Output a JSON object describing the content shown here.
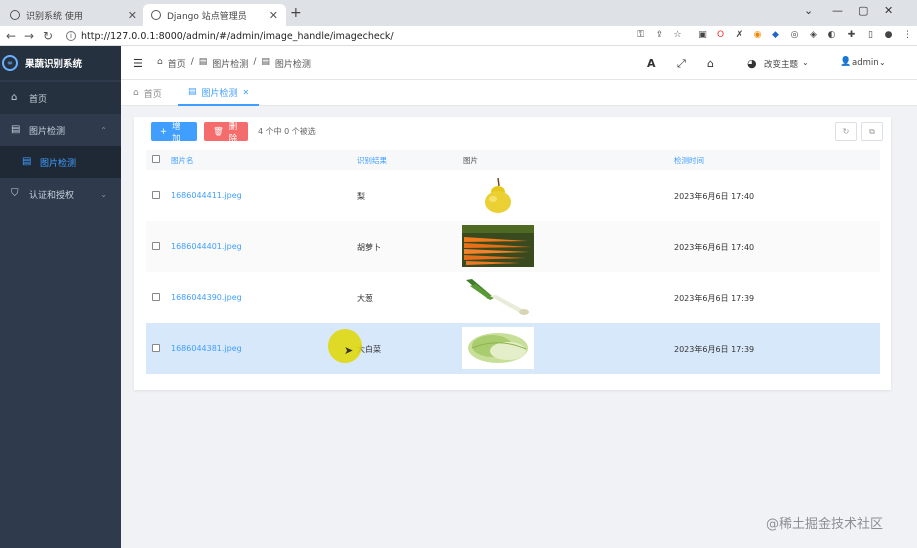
{
  "browser": {
    "tabs": [
      {
        "title": "识别系统 使用"
      },
      {
        "title": "Django 站点管理员"
      }
    ],
    "url": "http://127.0.0.1:8000/admin/#/admin/image_handle/imagecheck/"
  },
  "sidebar": {
    "brand": "果蔬识别系统",
    "items": [
      {
        "label": "首页",
        "icon": "home-icon"
      },
      {
        "label": "图片检测",
        "icon": "image-icon"
      },
      {
        "label": "图片检测",
        "icon": "image-icon"
      },
      {
        "label": "认证和授权",
        "icon": "shield-icon"
      }
    ]
  },
  "header": {
    "breadcrumb": [
      "首页",
      "/",
      "图片检测",
      "/",
      "图片检测"
    ],
    "font_label": "A",
    "theme_label": "改变主题",
    "user": "admin"
  },
  "content_tabs": [
    {
      "label": "首页"
    },
    {
      "label": "图片检测"
    }
  ],
  "toolbar": {
    "add_label": "增加",
    "delete_label": "删除",
    "selection_text": "4 个中 0 个被选"
  },
  "table": {
    "columns": [
      "图片名",
      "识别结果",
      "图片",
      "检测时间"
    ],
    "rows": [
      {
        "name": "1686044411.jpeg",
        "result": "梨",
        "time": "2023年6月6日 17:40",
        "image": "pear"
      },
      {
        "name": "1686044401.jpeg",
        "result": "胡萝卜",
        "time": "2023年6月6日 17:40",
        "image": "carrots"
      },
      {
        "name": "1686044390.jpeg",
        "result": "大葱",
        "time": "2023年6月6日 17:39",
        "image": "scallion"
      },
      {
        "name": "1686044381.jpeg",
        "result": "大白菜",
        "time": "2023年6月6日 17:39",
        "image": "napa-cabbage"
      }
    ]
  },
  "watermark": "@稀土掘金技术社区",
  "colors": {
    "accent": "#409eff",
    "danger": "#f56c6c",
    "sidebar": "#2f3b4d",
    "selected_row": "#d8e8fb"
  }
}
